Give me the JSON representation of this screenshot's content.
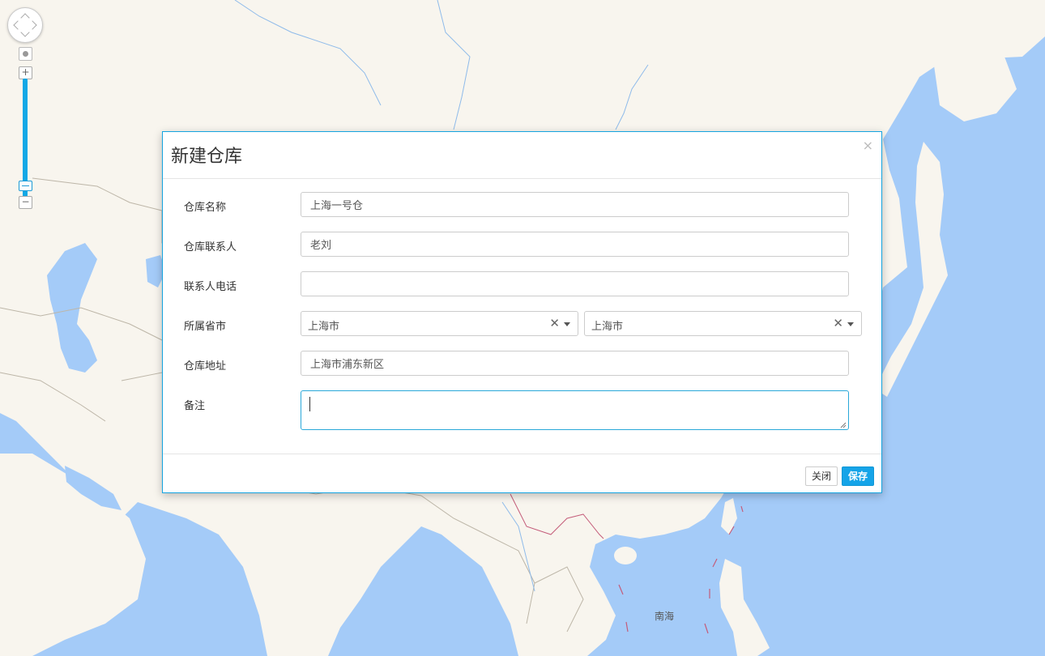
{
  "map": {
    "sea_label": "南海",
    "colors": {
      "water": "#a4cbf8",
      "land": "#f8f5ee",
      "border": "#bdb6a8"
    }
  },
  "map_controls": {
    "zoom_in_label": "+",
    "zoom_out_label": "−"
  },
  "dialog": {
    "title": "新建仓库",
    "close_glyph": "×",
    "fields": {
      "name": {
        "label": "仓库名称",
        "value": "上海一号仓"
      },
      "contact": {
        "label": "仓库联系人",
        "value": "老刘"
      },
      "phone": {
        "label": "联系人电话",
        "value": ""
      },
      "region": {
        "label": "所属省市",
        "province": "上海市",
        "city": "上海市",
        "clear_glyph": "✕"
      },
      "address": {
        "label": "仓库地址",
        "value": "上海市浦东新区"
      },
      "remark": {
        "label": "备注",
        "value": ""
      }
    },
    "buttons": {
      "close": "关闭",
      "save": "保存"
    },
    "colors": {
      "accent": "#15a4e8"
    }
  }
}
